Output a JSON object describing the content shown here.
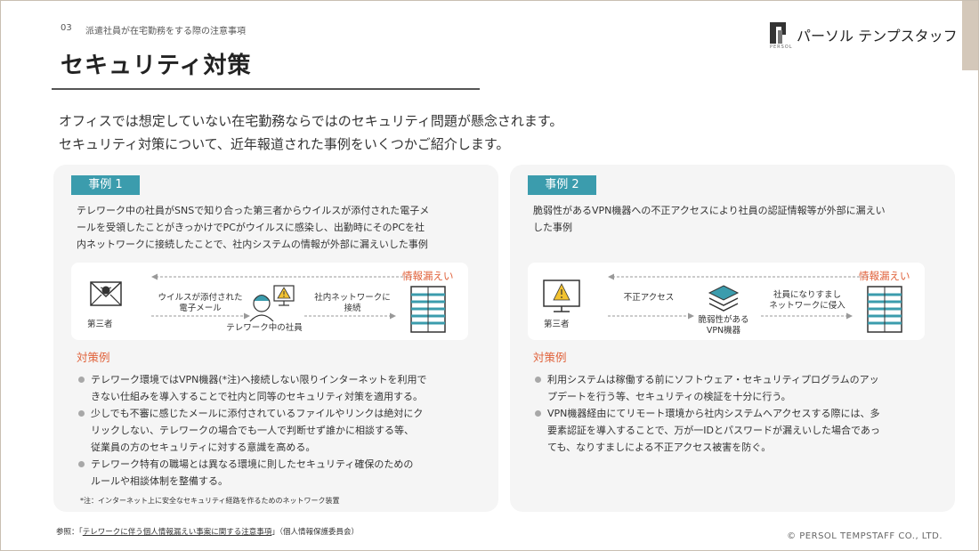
{
  "header": {
    "section_number": "03",
    "section_title": "派遣社員が在宅勤務をする際の注意事項",
    "title": "セキュリティ対策"
  },
  "logo": {
    "brand_text": "パーソル テンプスタッフ",
    "sub_text": "PERSOL"
  },
  "intro": {
    "line1": "オフィスでは想定していない在宅勤務ならではのセキュリティ問題が懸念されます。",
    "line2": "セキュリティ対策について、近年報道された事例をいくつかご紹介します。"
  },
  "case1": {
    "badge": "事例 1",
    "description": [
      "テレワーク中の社員がSNSで知り合った第三者からウイルスが添付された電子メ",
      "ールを受領したことがきっかけでPCがウイルスに感染し、出勤時にそのPCを社",
      "内ネットワークに接続したことで、社内システムの情報が外部に漏えいした事例"
    ],
    "diagram": {
      "leak_label": "情報漏えい",
      "third_party": "第三者",
      "arrow1_label": [
        "ウイルスが添付された",
        "電子メール"
      ],
      "worker_label": "テレワーク中の社員",
      "arrow2_label": [
        "社内ネットワークに",
        "接続"
      ]
    },
    "measures_title": "対策例",
    "measures": [
      [
        "テレワーク環境ではVPN機器(*注)へ接続しない限りインターネットを利用で",
        "きない仕組みを導入することで社内と同等のセキュリティ対策を適用する。"
      ],
      [
        "少しでも不審に感じたメールに添付されているファイルやリンクは絶対にク",
        "リックしない、テレワークの場合でも一人で判断せず誰かに相談する等、",
        "従業員の方のセキュリティに対する意識を高める。"
      ],
      [
        "テレワーク特有の職場とは異なる環境に則したセキュリティ確保のための",
        "ルールや相談体制を整備する。"
      ]
    ],
    "footnote": "*注：インターネット上に安全なセキュリティ経路を作るためのネットワーク装置"
  },
  "case2": {
    "badge": "事例 2",
    "description": [
      "脆弱性があるVPN機器への不正アクセスにより社員の認証情報等が外部に漏えい",
      "した事例"
    ],
    "diagram": {
      "leak_label": "情報漏えい",
      "third_party": "第三者",
      "arrow1_label": [
        "不正アクセス"
      ],
      "vpn_label": [
        "脆弱性がある",
        "VPN機器"
      ],
      "arrow2_label": [
        "社員になりすまし",
        "ネットワークに侵入"
      ]
    },
    "measures_title": "対策例",
    "measures": [
      [
        "利用システムは稼働する前にソフトウェア・セキュリティプログラムのアッ",
        "プデートを行う等、セキュリティの検証を十分に行う。"
      ],
      [
        "VPN機器経由にてリモート環境から社内システムへアクセスする際には、多",
        "要素認証を導入することで、万が一IDとパスワードが漏えいした場合であっ",
        "ても、なりすましによる不正アクセス被害を防ぐ。"
      ]
    ]
  },
  "footer": {
    "reference_prefix": "参照：「",
    "reference_link": "テレワークに伴う個人情報漏えい事案に関する注意事項",
    "reference_suffix": "」（個人情報保護委員会）",
    "copyright": "© PERSOL TEMPSTAFF CO., LTD."
  },
  "colors": {
    "accent": "#3b9cad",
    "leak": "#e0613a",
    "panel_bg": "#f5f5f5"
  }
}
